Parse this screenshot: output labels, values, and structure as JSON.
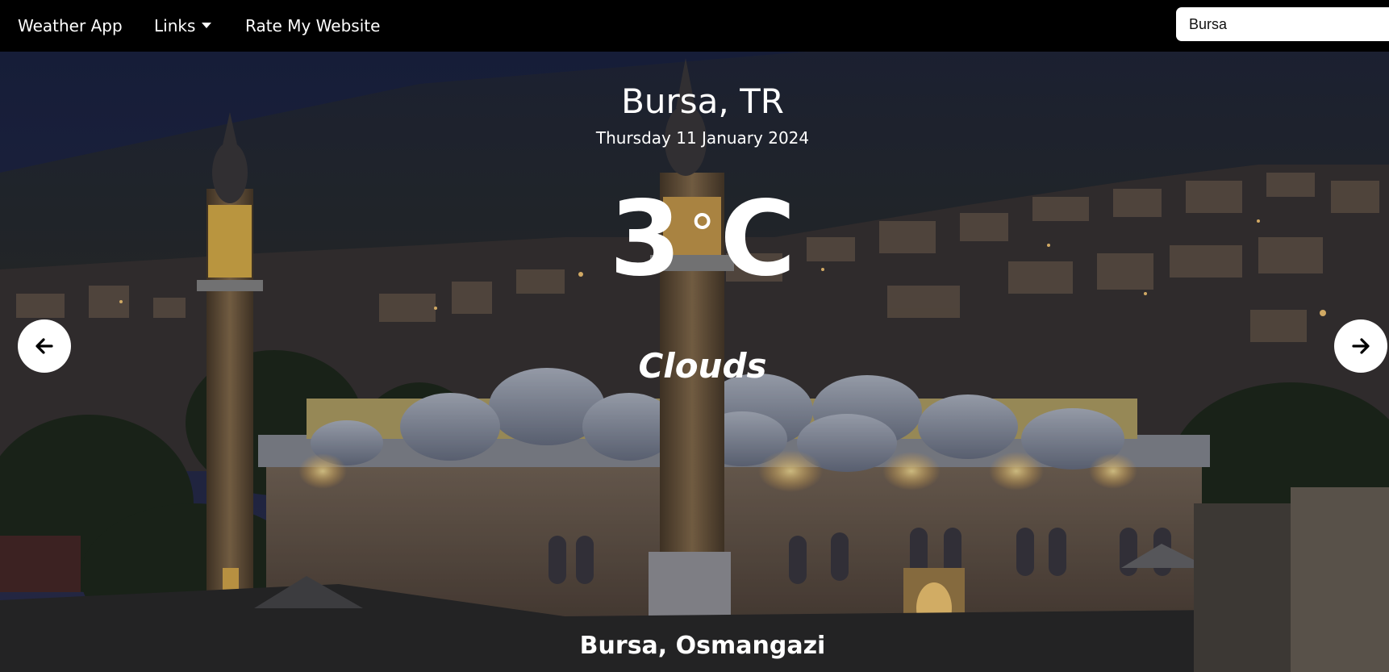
{
  "navbar": {
    "brand": "Weather App",
    "links_label": "Links",
    "rate_label": "Rate My Website"
  },
  "search": {
    "value": "Bursa"
  },
  "weather": {
    "location": "Bursa, TR",
    "date": "Thursday 11 January 2024",
    "temp_value": "3",
    "temp_degree": "°",
    "temp_unit": "C",
    "condition": "Clouds",
    "district": "Bursa, Osmangazi"
  },
  "icons": {
    "links_dropdown": "caret-down-icon",
    "prev": "arrow-left-icon",
    "next": "arrow-right-icon"
  }
}
